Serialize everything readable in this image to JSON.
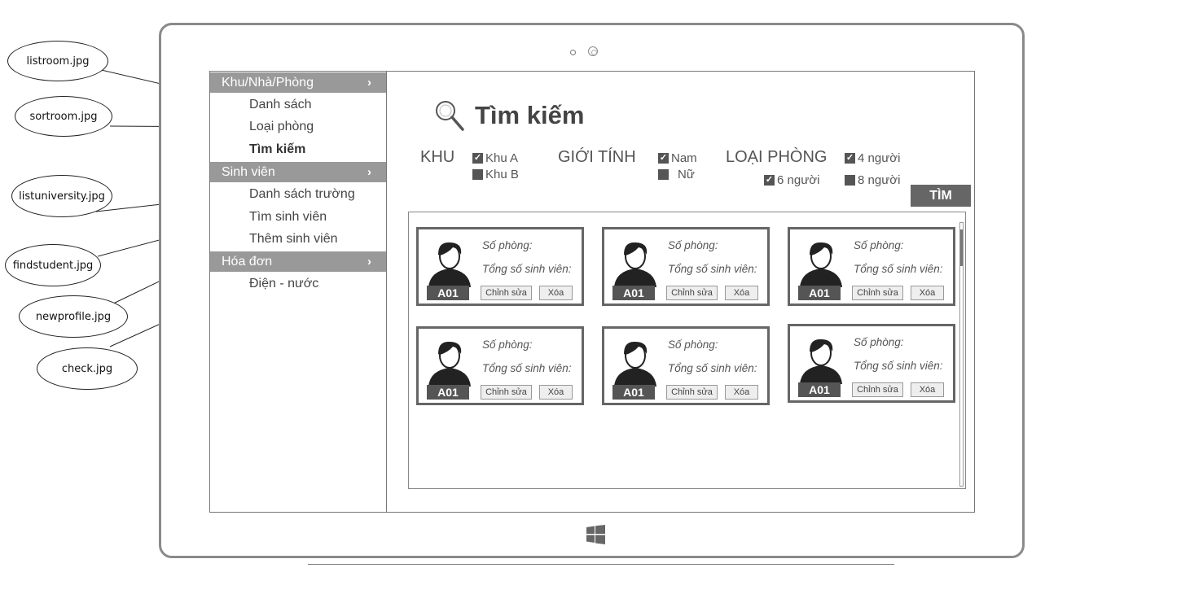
{
  "annotations": [
    {
      "label": "listroom.jpg"
    },
    {
      "label": "sortroom.jpg"
    },
    {
      "label": "listuniversity.jpg"
    },
    {
      "label": "findstudent.jpg"
    },
    {
      "label": "newprofile.jpg"
    },
    {
      "label": "check.jpg"
    }
  ],
  "sidebar": {
    "sections": [
      {
        "title": "Khu/Nhà/Phòng",
        "chevron": "›",
        "items": [
          "Danh sách",
          "Loại phòng",
          "Tìm kiếm"
        ]
      },
      {
        "title": "Sinh viên",
        "chevron": "›",
        "items": [
          "Danh sách trường",
          "Tìm sinh viên",
          "Thêm sinh viên"
        ]
      },
      {
        "title": "Hóa đơn",
        "chevron": "›",
        "items": [
          "Điện - nước"
        ]
      }
    ],
    "active_item": "Tìm kiếm"
  },
  "main": {
    "title": "Tìm kiếm",
    "search_icon": "magnifier-icon",
    "filters": {
      "khu": {
        "label": "KHU",
        "options": [
          {
            "label": "Khu A",
            "checked": true
          },
          {
            "label": "Khu B",
            "checked": false
          }
        ]
      },
      "gioi_tinh": {
        "label": "GIỚI TÍNH",
        "options": [
          {
            "label": "Nam",
            "checked": true
          },
          {
            "label": "Nữ",
            "checked": false
          }
        ]
      },
      "loai_phong": {
        "label": "LOẠI PHÒNG",
        "options": [
          {
            "label": "4 người",
            "checked": true
          },
          {
            "label": "6 người",
            "checked": true
          },
          {
            "label": "8 người",
            "checked": false
          }
        ]
      }
    },
    "find_button": "TÌM",
    "room_fields": {
      "room_no": "Số phòng:",
      "total_students": "Tổng số sinh viên:"
    },
    "card_buttons": {
      "edit": "Chỉnh sửa",
      "delete": "Xóa"
    },
    "rooms": [
      {
        "code": "A01"
      },
      {
        "code": "A01"
      },
      {
        "code": "A01"
      },
      {
        "code": "A01"
      },
      {
        "code": "A01"
      },
      {
        "code": "A01"
      }
    ]
  },
  "colors": {
    "sidebar_header": "#999999",
    "button_dark": "#666666",
    "frame": "#8a8a8a"
  }
}
